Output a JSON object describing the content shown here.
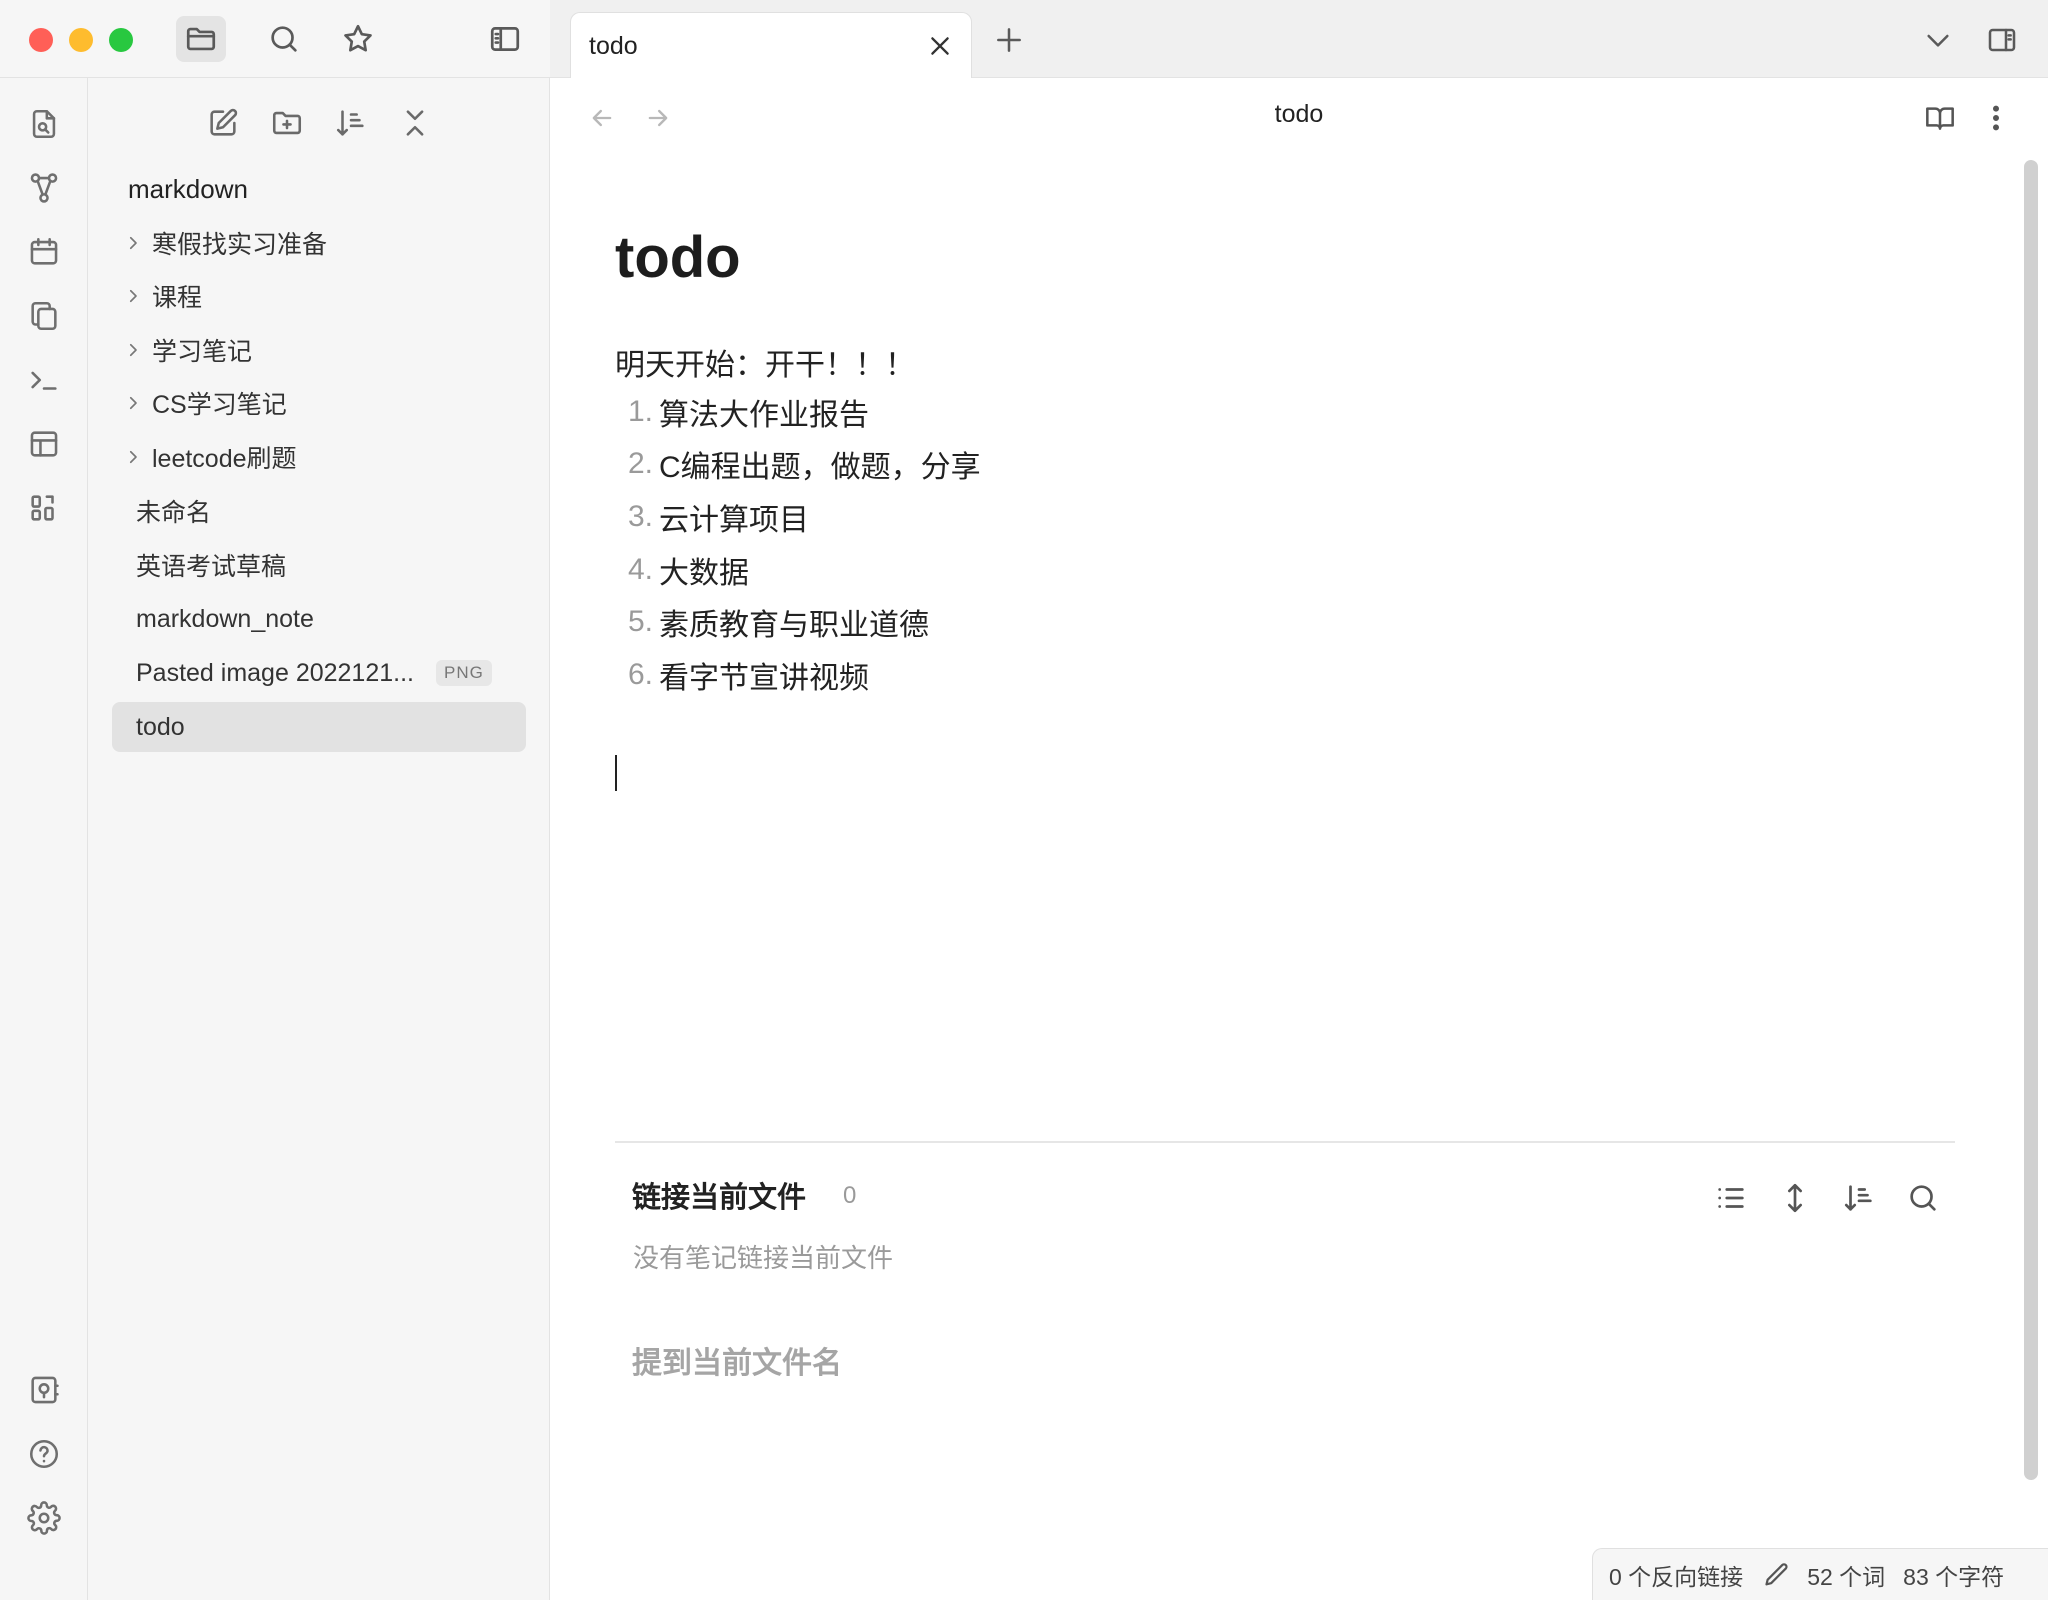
{
  "window": {
    "traffic_colors": [
      "#ff5f57",
      "#febc2e",
      "#28c840"
    ]
  },
  "titlebar": {
    "icons": [
      "folder-icon",
      "search-icon",
      "star-icon",
      "sidebar-toggle-icon"
    ]
  },
  "ribbon": {
    "icons": [
      "file-search-icon",
      "graph-icon",
      "calendar-icon",
      "copy-icon",
      "terminal-icon",
      "layout-icon",
      "blocks-icon",
      "vault-switch-icon",
      "help-icon",
      "settings-icon"
    ]
  },
  "sidebar": {
    "vault_name": "markdown",
    "items": [
      {
        "type": "folder",
        "label": "寒假找实习准备"
      },
      {
        "type": "folder",
        "label": "课程"
      },
      {
        "type": "folder",
        "label": "学习笔记"
      },
      {
        "type": "folder",
        "label": "CS学习笔记"
      },
      {
        "type": "folder",
        "label": "leetcode刷题"
      },
      {
        "type": "file",
        "label": "未命名"
      },
      {
        "type": "file",
        "label": "英语考试草稿"
      },
      {
        "type": "file",
        "label": "markdown_note"
      },
      {
        "type": "file",
        "label": "Pasted image 2022121...",
        "badge": "PNG"
      },
      {
        "type": "file",
        "label": "todo",
        "selected": true
      }
    ]
  },
  "tabs": {
    "active_title": "todo"
  },
  "note": {
    "header_title": "todo",
    "heading": "todo",
    "intro": "明天开始：开干！！！",
    "list": [
      {
        "num": "1.",
        "text": "算法大作业报告"
      },
      {
        "num": "2.",
        "text": "C编程出题，做题，分享"
      },
      {
        "num": "3.",
        "text": "云计算项目"
      },
      {
        "num": "4.",
        "text": "大数据"
      },
      {
        "num": "5.",
        "text": "素质教育与职业道德"
      },
      {
        "num": "6.",
        "text": "看字节宣讲视频"
      }
    ]
  },
  "backlinks": {
    "title": "链接当前文件",
    "count": "0",
    "empty": "没有笔记链接当前文件",
    "mentions_title": "提到当前文件名"
  },
  "status": {
    "backlinks": "0 个反向链接",
    "words": "52 个词",
    "chars": "83 个字符"
  }
}
